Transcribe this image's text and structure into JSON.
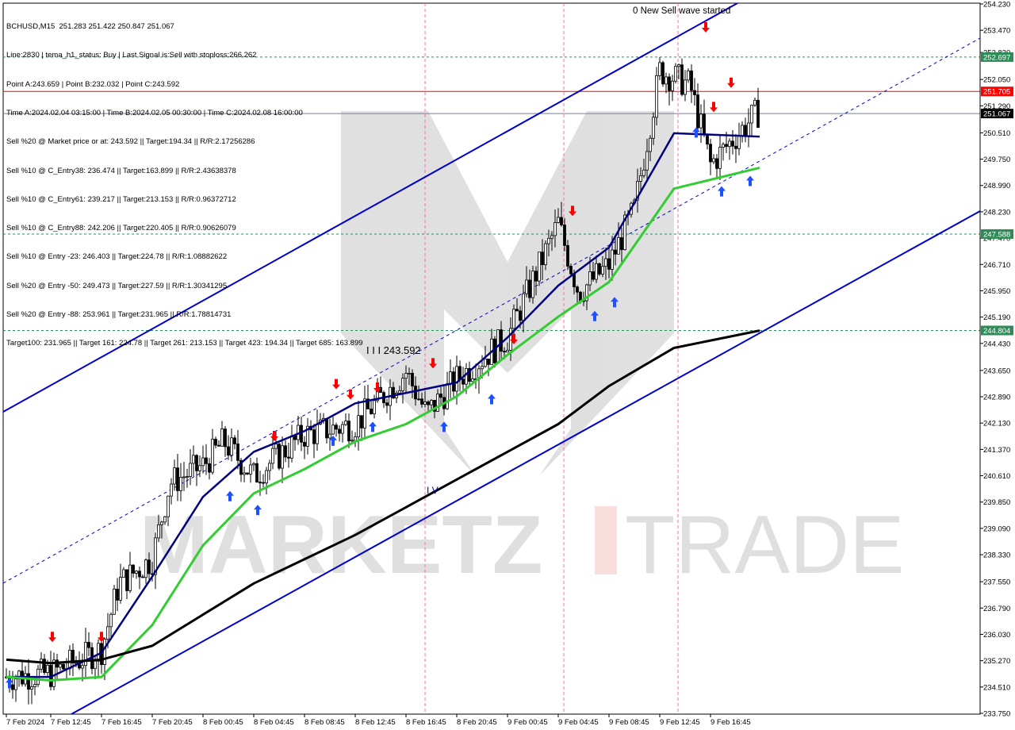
{
  "header": {
    "lines": [
      "BCHUSD,M15  251.283 251.422 250.847 251.067",
      "Line:2830 | tema_h1_status: Buy | Last Signal is:Sell with stoploss:266.262",
      "Point A:243.659 | Point B:232.032 | Point C:243.592",
      "Time A:2024.02.04 03:15:00 | Time B:2024.02.05 00:30:00 | Time C:2024.02.08 16:00:00",
      "Sell %20 @ Market price or at: 243.592 || Target:194.34 || R/R:2.17256286",
      "Sell %10 @ C_Entry38: 236.474 || Target:163.899 || R/R:2.43638378",
      "Sell %10 @ C_Entry61: 239.217 || Target:213.153 || R/R:0.96372712",
      "Sell %10 @ C_Entry88: 242.206 || Target:220.405 || R/R:0.90626079",
      "Sell %10 @ Entry -23: 246.403 || Target:224.78 || R/R:1.08882622",
      "Sell %20 @ Entry -50: 249.473 || Target:227.59 || R/R:1.30341295",
      "Sell %20 @ Entry -88: 253.961 || Target:231.965 || R/R:1.78814731",
      "Target100: 231.965 || Target 161: 224.78 || Target 261: 213.153 || Target 423: 194.34 || Target 685: 163.899"
    ]
  },
  "watermark": {
    "left": "MARKETZ",
    "right": "TRADE"
  },
  "annotations": {
    "wave_started": "0 New Sell wave started",
    "wave_label": "I I I 243.592",
    "wave_iv": "I V"
  },
  "colors": {
    "background": "#ffffff",
    "channel": "#0000cc",
    "ema_navy": "#000080",
    "ema_green": "#33cc33",
    "ema_black": "#000000",
    "level_green": "#2e8b57",
    "level_red": "#ff0000",
    "current_price_line": "#708090",
    "session_marker": "#ff69b4",
    "buy_arrow": "#1e50ff",
    "sell_arrow": "#ff0000"
  },
  "chart_data": {
    "type": "candlestick",
    "symbol": "BCHUSD",
    "timeframe": "M15",
    "ylim": [
      233.75,
      254.23
    ],
    "y_ticks": [
      "254.230",
      "253.470",
      "252.830",
      "252.050",
      "251.290",
      "250.510",
      "249.750",
      "248.990",
      "248.230",
      "247.470",
      "246.710",
      "245.950",
      "245.190",
      "244.430",
      "243.650",
      "242.890",
      "242.130",
      "241.370",
      "240.610",
      "239.850",
      "239.090",
      "238.330",
      "237.550",
      "236.790",
      "236.030",
      "235.270",
      "234.510",
      "233.750"
    ],
    "x_ticks": [
      "7 Feb 2024",
      "7 Feb 12:45",
      "7 Feb 16:45",
      "7 Feb 20:45",
      "8 Feb 00:45",
      "8 Feb 04:45",
      "8 Feb 08:45",
      "8 Feb 12:45",
      "8 Feb 16:45",
      "8 Feb 20:45",
      "9 Feb 00:45",
      "9 Feb 04:45",
      "9 Feb 08:45",
      "9 Feb 12:45",
      "9 Feb 16:45"
    ],
    "levels": [
      {
        "value": 252.697,
        "label": "252.697",
        "color": "#2e8b57",
        "style": "dashed"
      },
      {
        "value": 251.705,
        "label": "251.705",
        "color": "#ff0000",
        "style": "solid"
      },
      {
        "value": 251.067,
        "label": "251.067",
        "color": "#708090",
        "style": "solid",
        "current": true
      },
      {
        "value": 247.588,
        "label": "247.588",
        "color": "#2e8b57",
        "style": "dashed"
      },
      {
        "value": 244.804,
        "label": "244.804",
        "color": "#2e8b57",
        "style": "dashed"
      }
    ],
    "close_path": [
      [
        "7 Feb 2024",
        234.8
      ],
      [
        "7 Feb 12:45",
        234.9
      ],
      [
        "7 Feb 16:45",
        235.6
      ],
      [
        "7 Feb 16:45+",
        237.5
      ],
      [
        "7 Feb 20:45",
        238.2
      ],
      [
        "7 Feb 20:45+",
        240.4
      ],
      [
        "8 Feb 00:45",
        240.9
      ],
      [
        "8 Feb 00:45+",
        241.6
      ],
      [
        "8 Feb 04:45",
        240.6
      ],
      [
        "8 Feb 08:45",
        241.8
      ],
      [
        "8 Feb 12:45",
        242.1
      ],
      [
        "8 Feb 16:45",
        243.6
      ],
      [
        "8 Feb 16:45+",
        242.4
      ],
      [
        "8 Feb 20:45",
        243.4
      ],
      [
        "9 Feb 00:45",
        244.6
      ],
      [
        "9 Feb 04:45",
        247.9
      ],
      [
        "9 Feb 04:45+",
        245.9
      ],
      [
        "9 Feb 08:45",
        246.7
      ],
      [
        "9 Feb 08:45+",
        248.3
      ],
      [
        "9 Feb 12:45",
        252.3
      ],
      [
        "9 Feb 12:45+",
        251.9
      ],
      [
        "9 Feb 16:45",
        249.6
      ],
      [
        "9 Feb 16:45+",
        251.1
      ]
    ],
    "series": [
      {
        "name": "",
        "color": "#000080",
        "values": [
          234.8,
          234.8,
          235.5,
          237.7,
          240.0,
          241.3,
          241.9,
          242.7,
          243.0,
          243.3,
          244.6,
          246.1,
          247.2,
          250.5,
          250.4
        ]
      },
      {
        "name": "",
        "color": "#33cc33",
        "values": [
          234.8,
          234.7,
          234.8,
          236.3,
          238.6,
          240.1,
          240.8,
          241.6,
          242.1,
          242.9,
          244.1,
          245.2,
          246.2,
          248.9,
          249.5
        ]
      },
      {
        "name": "",
        "color": "#000000",
        "values": [
          235.3,
          235.2,
          235.3,
          235.7,
          236.6,
          237.5,
          238.2,
          238.9,
          239.7,
          240.5,
          241.3,
          242.1,
          243.2,
          244.3,
          244.8
        ]
      }
    ]
  }
}
